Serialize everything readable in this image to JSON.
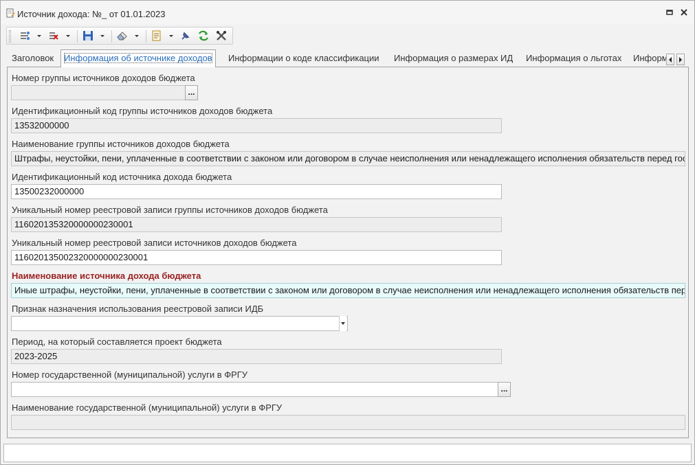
{
  "window": {
    "title": "Источник дохода: №_ от 01.01.2023"
  },
  "icons": {
    "title": "document-edit-icon",
    "restore": "restore-window-icon",
    "close": "close-icon",
    "toolbar": [
      "link-icon",
      "delete-link-icon",
      "save-icon",
      "eraser-icon",
      "document-notes-icon",
      "pin-icon",
      "refresh-icon",
      "tools-icon"
    ]
  },
  "tabs": [
    {
      "label": "Заголовок",
      "active": false
    },
    {
      "label": "Информация об источнике доходов",
      "active": true
    },
    {
      "label": "Информации о коде классификации",
      "active": false
    },
    {
      "label": "Информация о размерах ИД",
      "active": false
    },
    {
      "label": "Информация о льготах",
      "active": false
    },
    {
      "label": "Информ",
      "active": false
    }
  ],
  "form": {
    "group_number": {
      "label": "Номер группы источников доходов бюджета",
      "value": ""
    },
    "group_id_code": {
      "label": "Идентификационный код группы источников доходов бюджета",
      "value": "13532000000"
    },
    "group_name": {
      "label": "Наименование группы источников доходов бюджета",
      "value": "Штрафы, неустойки, пени, уплаченные в соответствии с законом или договором в случае неисполнения или ненадлежащего исполнения обязательств перед гос"
    },
    "source_id_code": {
      "label": "Идентификационный код источника дохода бюджета",
      "value": "13500232000000"
    },
    "group_registry_number": {
      "label": "Уникальный номер реестровой записи группы источников доходов бюджета",
      "value": "1160201353200000002300­01"
    },
    "source_registry_number": {
      "label": "Уникальный номер реестровой записи источников доходов бюджета",
      "value": "116020135002320000000230001"
    },
    "source_name": {
      "label": "Наименование источника дохода бюджета",
      "value": "Иные штрафы, неустойки, пени, уплаченные в соответствии с законом или договором в случае неисполнения или ненадлежащего исполнения обязательств пере"
    },
    "purpose_flag": {
      "label": "Признак назначения использования реестровой записи ИДБ",
      "value": ""
    },
    "period": {
      "label": "Период, на который составляется проект бюджета",
      "value": "2023-2025"
    },
    "service_number": {
      "label": "Номер государственной (муниципальной) услуги в ФРГУ",
      "value": ""
    },
    "service_name": {
      "label": "Наименование государственной (муниципальной) услуги в ФРГУ",
      "value": ""
    }
  },
  "buttons": {
    "ellipsis": "..."
  },
  "colors": {
    "required_label": "#9b2222",
    "active_tab_text": "#2a6ebb",
    "highlight_field": "#e8fafa"
  }
}
